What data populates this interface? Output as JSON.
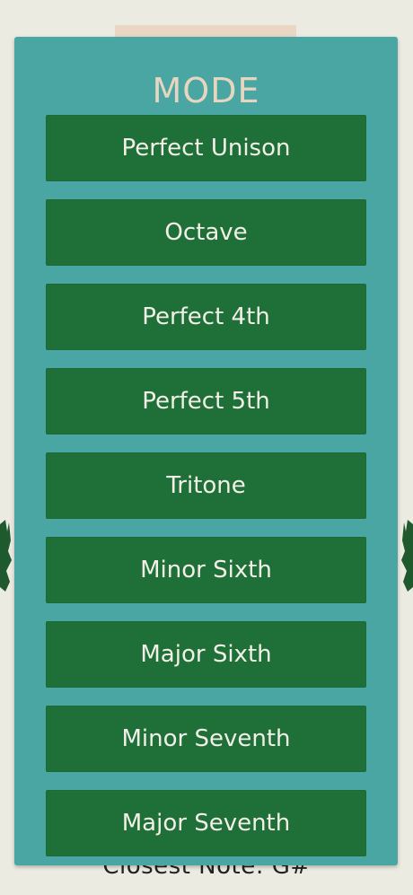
{
  "modal": {
    "title": "MODE",
    "options": [
      {
        "label": "Perfect Unison"
      },
      {
        "label": "Octave"
      },
      {
        "label": "Perfect 4th"
      },
      {
        "label": "Perfect 5th"
      },
      {
        "label": "Tritone"
      },
      {
        "label": "Minor Sixth"
      },
      {
        "label": "Major Sixth"
      },
      {
        "label": "Minor Seventh"
      },
      {
        "label": "Major Seventh"
      }
    ]
  },
  "background": {
    "closest_note_text": "Closest Note: G#"
  },
  "colors": {
    "page_background": "#ecebe1",
    "modal_background": "#4aa6a3",
    "button_background": "#1f6f38",
    "title_color": "#e7d6bf",
    "button_text": "#f2f0e7"
  }
}
